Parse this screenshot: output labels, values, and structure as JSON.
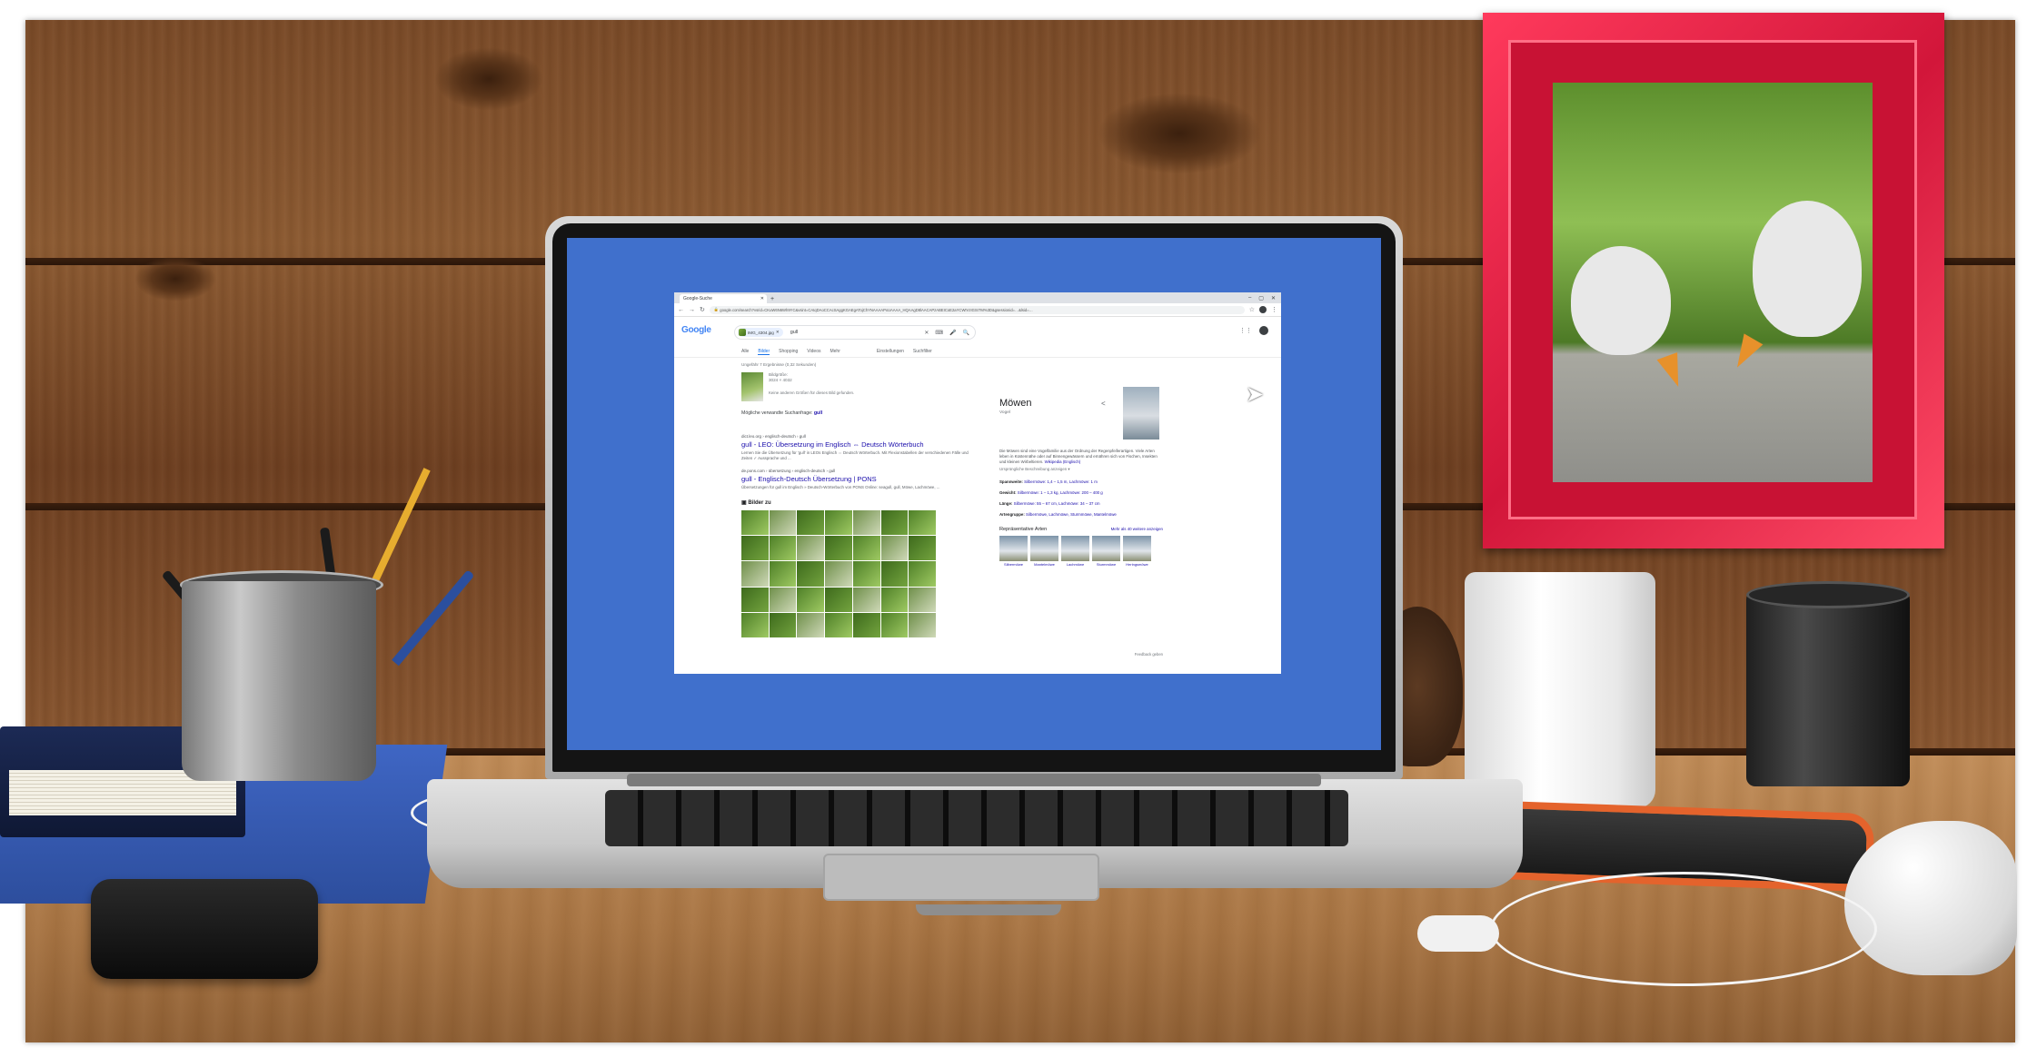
{
  "browser": {
    "tab_title": "Google-Suche",
    "new_tab": "+",
    "window_controls": [
      "–",
      "▢",
      "✕"
    ],
    "url": "google.com/search?vsrid=CKuW6N6Wh9YC&vsint=CAIqDAoCCAcSAggKGAEgATojChYNAAAAPxUAAAA_HQAAgD8lAACAPzABEICoE2aYCWIVzIGSr7M%3D&gsessionid=…&lsid=…"
  },
  "google": {
    "logo": "Google",
    "chip_label": "IMG_4304.jpg",
    "query": "gull",
    "tabs": [
      "Alle",
      "Bilder",
      "Shopping",
      "Videos",
      "Mehr"
    ],
    "tools": [
      "Einstellungen",
      "Suchfilter"
    ],
    "stats": "Ungefähr 7 Ergebnisse (0,32 Sekunden)",
    "image_meta": [
      "Bildgröße:",
      "3024 × 4032"
    ],
    "no_other_sizes": "Keine anderen Größen für dieses Bild gefunden.",
    "best_guess_label": "Mögliche verwandte Suchanfrage:",
    "best_guess_value": "gull",
    "result1_crumb": "dict.leo.org › englisch-deutsch › gull",
    "result1_title": "gull - LEO: Übersetzung im Englisch ⇔ Deutsch Wörterbuch",
    "result1_snippet": "Lernen Sie die Übersetzung für 'gull' in LEOs Englisch ⇔ Deutsch Wörterbuch. Mit Flexionstabellen der verschiedenen Fälle und Zeiten ✓ Aussprache und ...",
    "result2_crumb": "de.pons.com › übersetzung › englisch-deutsch › gull",
    "result2_title": "gull - Englisch-Deutsch Übersetzung | PONS",
    "result2_snippet": "Übersetzungen für gull im Englisch » Deutsch-Wörterbuch von PONS Online: seagull, gull, Möwe, Lachmöwe, ...",
    "images_heading": "Bilder zu",
    "kp": {
      "title": "Möwen",
      "subtitle": "Vogel",
      "share": "<",
      "description": "Die Möwen sind eine Vogelfamilie aus der Ordnung der Regenpfeiferartigen. Viele Arten leben in Küstennähe oder auf Binnengewässern und ernähren sich von Fischen, Insekten und kleinen Wirbeltieren.",
      "wiki": "Wikipedia (Englisch)",
      "more": "Ursprüngliche Beschreibung anzeigen ▾",
      "facts": [
        {
          "k": "Spannweite:",
          "v": "Silbermöwe: 1,4 – 1,5 m, Lachmöwe: 1 m"
        },
        {
          "k": "Gewicht:",
          "v": "Silbermöwe: 1 – 1,3 kg, Lachmöwe: 200 – 400 g"
        },
        {
          "k": "Länge:",
          "v": "Silbermöwe: 55 – 67 cm, Lachmöwe: 34 – 37 cm"
        },
        {
          "k": "Artengruppe:",
          "v": "Silbermöwe, Lachmöwe, Sturmmöwe, Mantelmöwe"
        }
      ],
      "section_title": "Repräsentative Arten",
      "section_more": "Mehr als 40 weitere anzeigen",
      "species": [
        "Silbermöwe",
        "Mantelmöwe",
        "Lachmöwe",
        "Sturmmöwe",
        "Heringsmöwe"
      ],
      "feedback": "Feedback geben"
    }
  }
}
